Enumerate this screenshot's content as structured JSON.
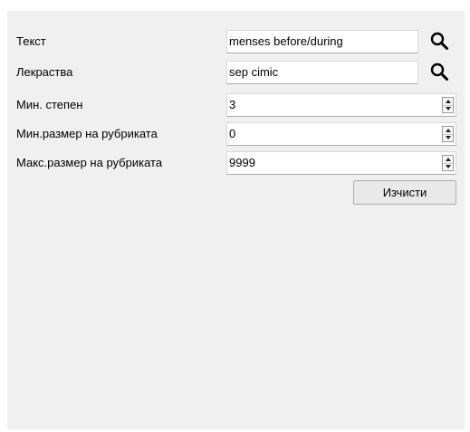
{
  "form": {
    "text_label": "Текст",
    "text_value": "menses before/during",
    "drugs_label": "Лекраства",
    "drugs_value": "sep cimic",
    "min_degree_label": "Мин. степен",
    "min_degree_value": "3",
    "min_size_label": "Мин.размер на рубриката",
    "min_size_value": "0",
    "max_size_label": "Макс.размер на рубриката",
    "max_size_value": "9999",
    "clear_label": "Изчисти"
  },
  "icons": {
    "search": "search-icon",
    "spin_up": "arrow-up-icon",
    "spin_down": "arrow-down-icon"
  },
  "colors": {
    "panel_background": "#f0f0f0",
    "field_background": "#ffffff",
    "button_background": "#e9e9e9"
  }
}
